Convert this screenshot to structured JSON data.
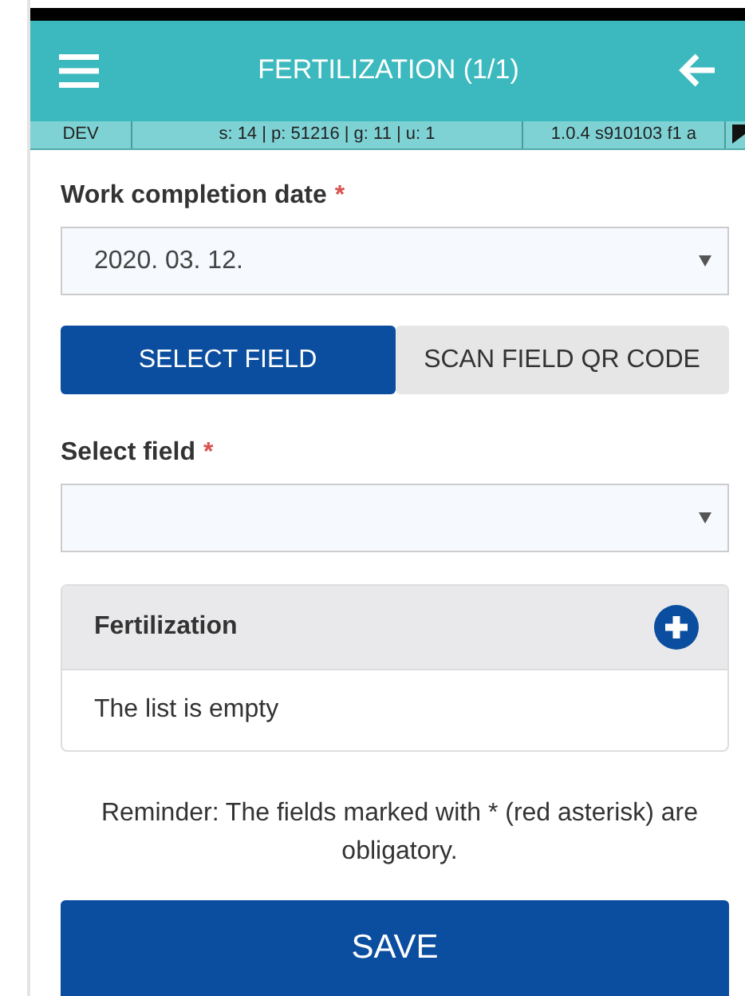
{
  "header": {
    "title": "FERTILIZATION (1/1)"
  },
  "status_bar": {
    "env": "DEV",
    "stats": "s: 14 | p: 51216 | g: 11 | u: 1",
    "version": "1.0.4 s910103 f1 a"
  },
  "date_field": {
    "label": "Work completion date",
    "required_mark": "*",
    "value": "2020. 03. 12."
  },
  "tabs": [
    {
      "label": "SELECT FIELD",
      "selected": true
    },
    {
      "label": "SCAN FIELD QR CODE",
      "selected": false
    }
  ],
  "field_select": {
    "label": "Select field",
    "required_mark": "*"
  },
  "list_panel": {
    "title": "Fertilization",
    "empty_text": "The list is empty"
  },
  "reminder": "Reminder: The fields marked with * (red asterisk) are obligatory.",
  "save_button": "SAVE"
}
